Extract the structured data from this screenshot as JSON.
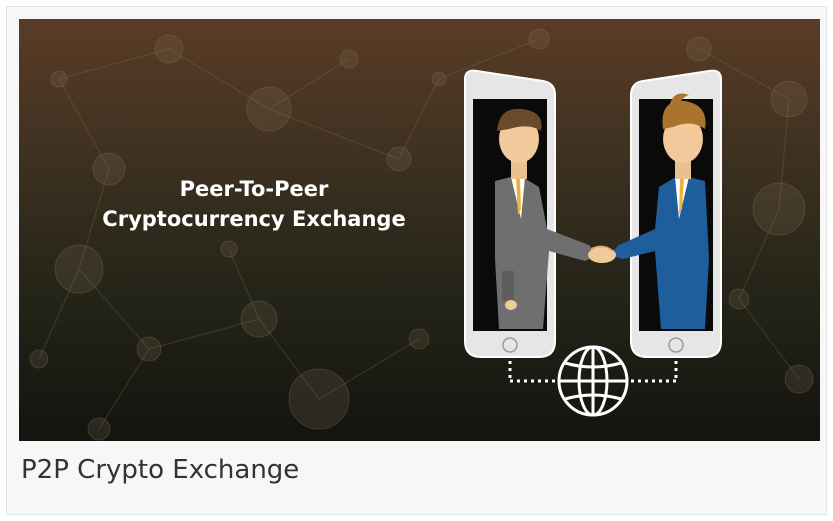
{
  "banner": {
    "headline_line1": "Peer-To-Peer",
    "headline_line2": "Cryptocurrency Exchange",
    "illustration_icons": [
      "phone-left-icon",
      "phone-right-icon",
      "handshake-icon",
      "globe-icon",
      "network-nodes-icon"
    ]
  },
  "caption": {
    "text": "P2P Crypto Exchange"
  },
  "colors": {
    "banner_top": "#5a3c26",
    "banner_bottom": "#141410",
    "headline_text": "#ffffff",
    "caption_text": "#333333",
    "card_background": "#f7f7f7"
  }
}
